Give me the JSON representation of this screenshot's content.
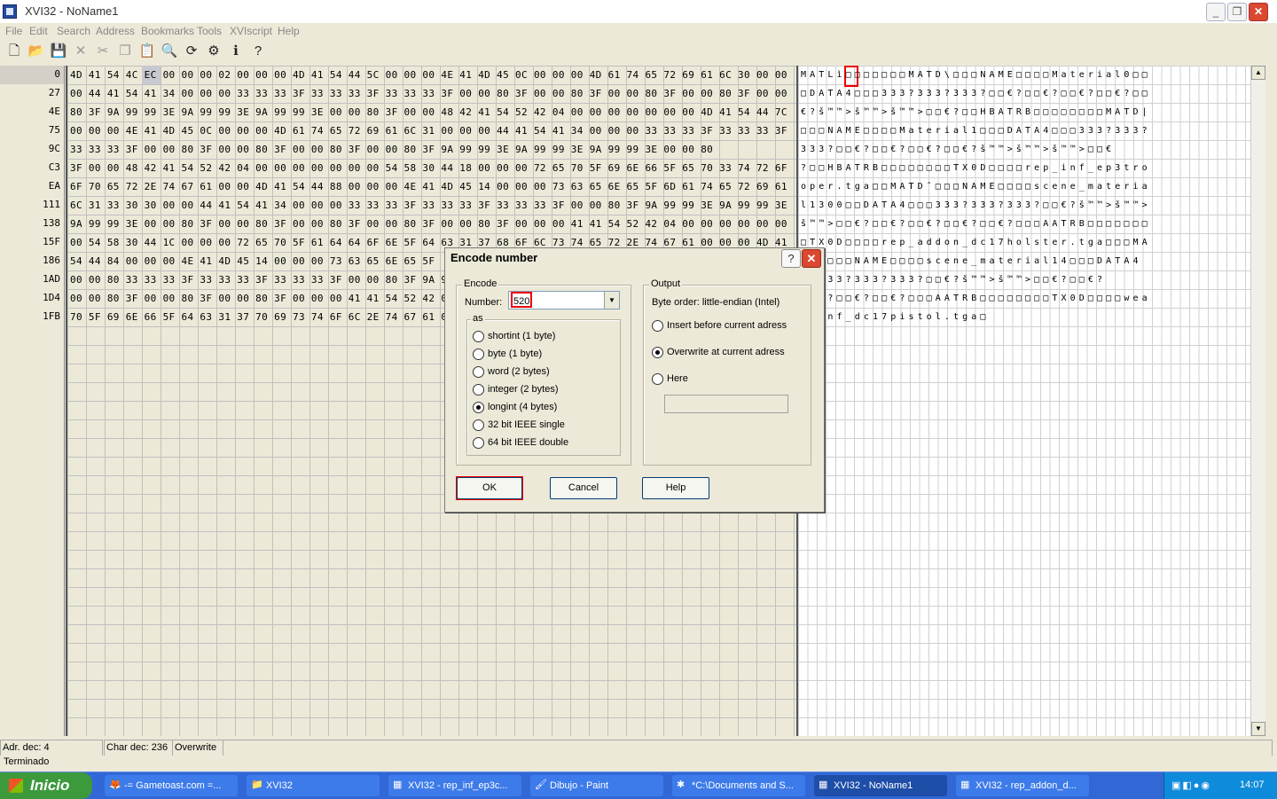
{
  "window": {
    "title": "XVI32 - NoName1"
  },
  "menu": [
    "File",
    "Edit",
    "Search",
    "Address",
    "Bookmarks",
    "Tools",
    "XVIscript",
    "Help"
  ],
  "toolbar_icons": [
    "new-file-icon",
    "open-folder-icon",
    "save-icon",
    "delete-icon",
    "cut-icon",
    "copy-icon",
    "paste-icon",
    "find-icon",
    "replace-icon",
    "script-icon",
    "info-icon",
    "context-help-icon"
  ],
  "addresses": [
    "0",
    "27",
    "4E",
    "75",
    "9C",
    "C3",
    "EA",
    "111",
    "138",
    "15F",
    "186",
    "1AD",
    "1D4",
    "1FB"
  ],
  "hex_rows": [
    "4D 41 54 4C EC 00 00 00 02 00 00 00 4D 41 54 44 5C 00 00 00 4E 41 4D 45 0C 00 00 00 4D 61 74 65 72 69 61 6C 30 00 00",
    "00 44 41 54 41 34 00 00 00 33 33 33 3F 33 33 33 3F 33 33 33 3F 00 00 80 3F 00 00 80 3F 00 00 80 3F 00 00 80 3F 00 00",
    "80 3F 9A 99 99 3E 9A 99 99 3E 9A 99 99 3E 00 00 80 3F 00 00 48 42 41 54 52 42 04 00 00 00 00 00 00 00 4D 41 54 44 7C",
    "00 00 00 4E 41 4D 45 0C 00 00 00 4D 61 74 65 72 69 61 6C 31 00 00 00 44 41 54 41 34 00 00 00 33 33 33 3F 33 33 33 3F",
    "33 33 33 3F 00 00 80 3F 00 00 80 3F 00 00 80 3F 00 00 80 3F 9A 99 99 3E 9A 99 99 3E 9A 99 99 3E 00 00 80",
    "3F 00 00 48 42 41 54 52 42 04 00 00 00 00 00 00 00 54 58 30 44 18 00 00 00 72 65 70 5F 69 6E 66 5F 65 70 33 74 72 6F",
    "6F 70 65 72 2E 74 67 61 00 00 4D 41 54 44 88 00 00 00 4E 41 4D 45 14 00 00 00 73 63 65 6E 65 5F 6D 61 74 65 72 69 61",
    "6C 31 33 30 30 00 00 44 41 54 41 34 00 00 00 33 33 33 3F 33 33 33 3F 33 33 33 3F 00 00 80 3F 9A 99 99 3E 9A 99 99 3E",
    "9A 99 99 3E 00 00 80 3F 00 00 80 3F 00 00 80 3F 00 00 80 3F 00 00 80 3F 00 00 00 41 41 54 52 42 04 00 00 00 00 00 00",
    "00 54 58 30 44 1C 00 00 00 72 65 70 5F 61 64 64 6F 6E 5F 64 63 31 37 68 6F 6C 73 74 65 72 2E 74 67 61 00 00 00 4D 41",
    "54 44 84 00 00 00 4E 41 4D 45 14 00 00 00 73 63 65 6E 65 5F",
    "00 00 80 33 33 33 3F 33 33 33 3F 33 33 33 3F 00 00 80 3F 9A 9",
    "00 00 80 3F 00 00 80 3F 00 00 80 3F 00 00 00 41 41 54 52 42 0",
    "70 5F 69 6E 66 5F 64 63 31 37 70 69 73 74 6F 6C 2E 74 67 61 0"
  ],
  "text_rows": [
    "MATLì□□□□□□□MATD\\□□□NAME□□□□Material0□□",
    "□DATA4□□□333?333?333?□□€?□□€?□□€?□□€?□□",
    "€?š™™>š™™>š™™>□□€?□□HBATRB□□□□□□□□MATD|",
    "□□□NAME□□□□Material1□□□DATA4□□□333?333?",
    "333?□□€?□□€?□□€?□□€?š™™>š™™>š™™>□□€",
    "?□□HBATRB□□□□□□□□TX0D□□□□rep_inf_ep3tro",
    "oper.tga□□MATDˆ□□□NAME□□□□scene_materia",
    "l1300□□DATA4□□□333?333?333?□□€?š™™>š™™>",
    "š™™>□□€?□□€?□□€?□□€?□□€?□□□AATRB□□□□□□□",
    "□TX0D□□□□rep_addon_dc17holster.tga□□□MA",
    "TD„□□□NAME□□□□scene_material14□□□DATA4",
    "□□333?333?333?□□€?š™™>š™™>□□€?□□€?",
    "□□€?□□€?□□€?□□□AATRB□□□□□□□□TX0D□□□□wea",
    "p_inf_dc17pistol.tga□"
  ],
  "status": {
    "addr": "Adr. dec: 4",
    "char": "Char dec: 236",
    "mode": "Overwrite",
    "bottom": "Terminado"
  },
  "dialog": {
    "title": "Encode number",
    "encode_group": "Encode",
    "number_label": "Number:",
    "number_value": "520",
    "as_label": "as",
    "as_options": [
      "shortint (1 byte)",
      "byte (1 byte)",
      "word (2 bytes)",
      "integer (2 bytes)",
      "longint (4 bytes)",
      "32 bit IEEE single",
      "64 bit IEEE double"
    ],
    "as_selected": 4,
    "output_group": "Output",
    "byte_order": "Byte order: little-endian (Intel)",
    "output_options": [
      "Insert before current adress",
      "Overwrite at current adress",
      "Here"
    ],
    "output_selected": 1,
    "ok": "OK",
    "cancel": "Cancel",
    "help": "Help"
  },
  "taskbar": {
    "start": "Inicio",
    "tasks": [
      "-= Gametoast.com =...",
      "XVI32",
      "XVI32 - rep_inf_ep3c...",
      "Dibujo - Paint",
      "*C:\\Documents and S...",
      "XVI32 - NoName1",
      "XVI32 - rep_addon_d..."
    ],
    "active": 5,
    "clock": "14:07"
  }
}
